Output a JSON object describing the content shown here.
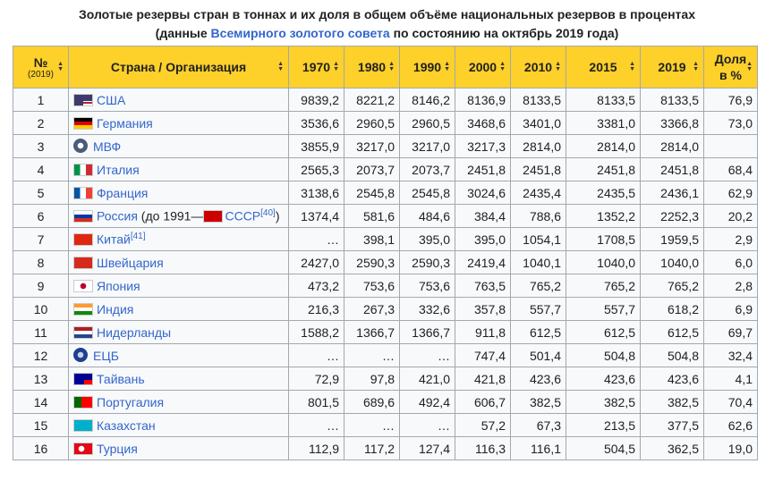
{
  "caption": {
    "line1": "Золотые резервы стран в тоннах и их доля в общем объёме национальных резервов в процентах",
    "line2_pre": "(данные ",
    "line2_link": "Всемирного золотого совета",
    "line2_post": " по состоянию на октябрь 2019 года)"
  },
  "headers": {
    "rank": "№",
    "rank_sub": "(2019)",
    "country": "Страна / Организация",
    "y1970": "1970",
    "y1980": "1980",
    "y1990": "1990",
    "y2000": "2000",
    "y2010": "2010",
    "y2015": "2015",
    "y2019": "2019",
    "share": "Доля в %"
  },
  "rows": [
    {
      "rank": "1",
      "name": "США",
      "note": "",
      "sup": "",
      "flag": "usa",
      "v": [
        "9839,2",
        "8221,2",
        "8146,2",
        "8136,9",
        "8133,5",
        "8133,5",
        "8133,5",
        "76,9"
      ]
    },
    {
      "rank": "2",
      "name": "Германия",
      "note": "",
      "sup": "",
      "flag": "germany",
      "v": [
        "3536,6",
        "2960,5",
        "2960,5",
        "3468,6",
        "3401,0",
        "3381,0",
        "3366,8",
        "73,0"
      ]
    },
    {
      "rank": "3",
      "name": "МВФ",
      "note": "",
      "sup": "",
      "flag": "imf",
      "v": [
        "3855,9",
        "3217,0",
        "3217,0",
        "3217,3",
        "2814,0",
        "2814,0",
        "2814,0",
        ""
      ]
    },
    {
      "rank": "4",
      "name": "Италия",
      "note": "",
      "sup": "",
      "flag": "italy",
      "v": [
        "2565,3",
        "2073,7",
        "2073,7",
        "2451,8",
        "2451,8",
        "2451,8",
        "2451,8",
        "68,4"
      ]
    },
    {
      "rank": "5",
      "name": "Франция",
      "note": "",
      "sup": "",
      "flag": "france",
      "v": [
        "3138,6",
        "2545,8",
        "2545,8",
        "3024,6",
        "2435,4",
        "2435,5",
        "2436,1",
        "62,9"
      ]
    },
    {
      "rank": "6",
      "name": "Россия",
      "note": " (до 1991—",
      "note_link": "СССР",
      "note_end": ")",
      "sup": "[40]",
      "flag": "russia",
      "v": [
        "1374,4",
        "581,6",
        "484,6",
        "384,4",
        "788,6",
        "1352,2",
        "2252,3",
        "20,2"
      ]
    },
    {
      "rank": "7",
      "name": "Китай",
      "note": "",
      "sup": "[41]",
      "flag": "china",
      "v": [
        "…",
        "398,1",
        "395,0",
        "395,0",
        "1054,1",
        "1708,5",
        "1959,5",
        "2,9"
      ]
    },
    {
      "rank": "8",
      "name": "Швейцария",
      "note": "",
      "sup": "",
      "flag": "swiss",
      "v": [
        "2427,0",
        "2590,3",
        "2590,3",
        "2419,4",
        "1040,1",
        "1040,0",
        "1040,0",
        "6,0"
      ]
    },
    {
      "rank": "9",
      "name": "Япония",
      "note": "",
      "sup": "",
      "flag": "japan",
      "v": [
        "473,2",
        "753,6",
        "753,6",
        "763,5",
        "765,2",
        "765,2",
        "765,2",
        "2,8"
      ]
    },
    {
      "rank": "10",
      "name": "Индия",
      "note": "",
      "sup": "",
      "flag": "india",
      "v": [
        "216,3",
        "267,3",
        "332,6",
        "357,8",
        "557,7",
        "557,7",
        "618,2",
        "6,9"
      ]
    },
    {
      "rank": "11",
      "name": "Нидерланды",
      "note": "",
      "sup": "",
      "flag": "netherlands",
      "v": [
        "1588,2",
        "1366,7",
        "1366,7",
        "911,8",
        "612,5",
        "612,5",
        "612,5",
        "69,7"
      ]
    },
    {
      "rank": "12",
      "name": "ЕЦБ",
      "note": "",
      "sup": "",
      "flag": "ecb",
      "v": [
        "…",
        "…",
        "…",
        "747,4",
        "501,4",
        "504,8",
        "504,8",
        "32,4"
      ]
    },
    {
      "rank": "13",
      "name": "Тайвань",
      "note": "",
      "sup": "",
      "flag": "taiwan",
      "v": [
        "72,9",
        "97,8",
        "421,0",
        "421,8",
        "423,6",
        "423,6",
        "423,6",
        "4,1"
      ]
    },
    {
      "rank": "14",
      "name": "Португалия",
      "note": "",
      "sup": "",
      "flag": "portugal",
      "v": [
        "801,5",
        "689,6",
        "492,4",
        "606,7",
        "382,5",
        "382,5",
        "382,5",
        "70,4"
      ]
    },
    {
      "rank": "15",
      "name": "Казахстан",
      "note": "",
      "sup": "",
      "flag": "kazakhstan",
      "v": [
        "…",
        "…",
        "…",
        "57,2",
        "67,3",
        "213,5",
        "377,5",
        "62,6"
      ]
    },
    {
      "rank": "16",
      "name": "Турция",
      "note": "",
      "sup": "",
      "flag": "turkey",
      "v": [
        "112,9",
        "117,2",
        "127,4",
        "116,3",
        "116,1",
        "504,5",
        "362,5",
        "19,0"
      ]
    }
  ]
}
